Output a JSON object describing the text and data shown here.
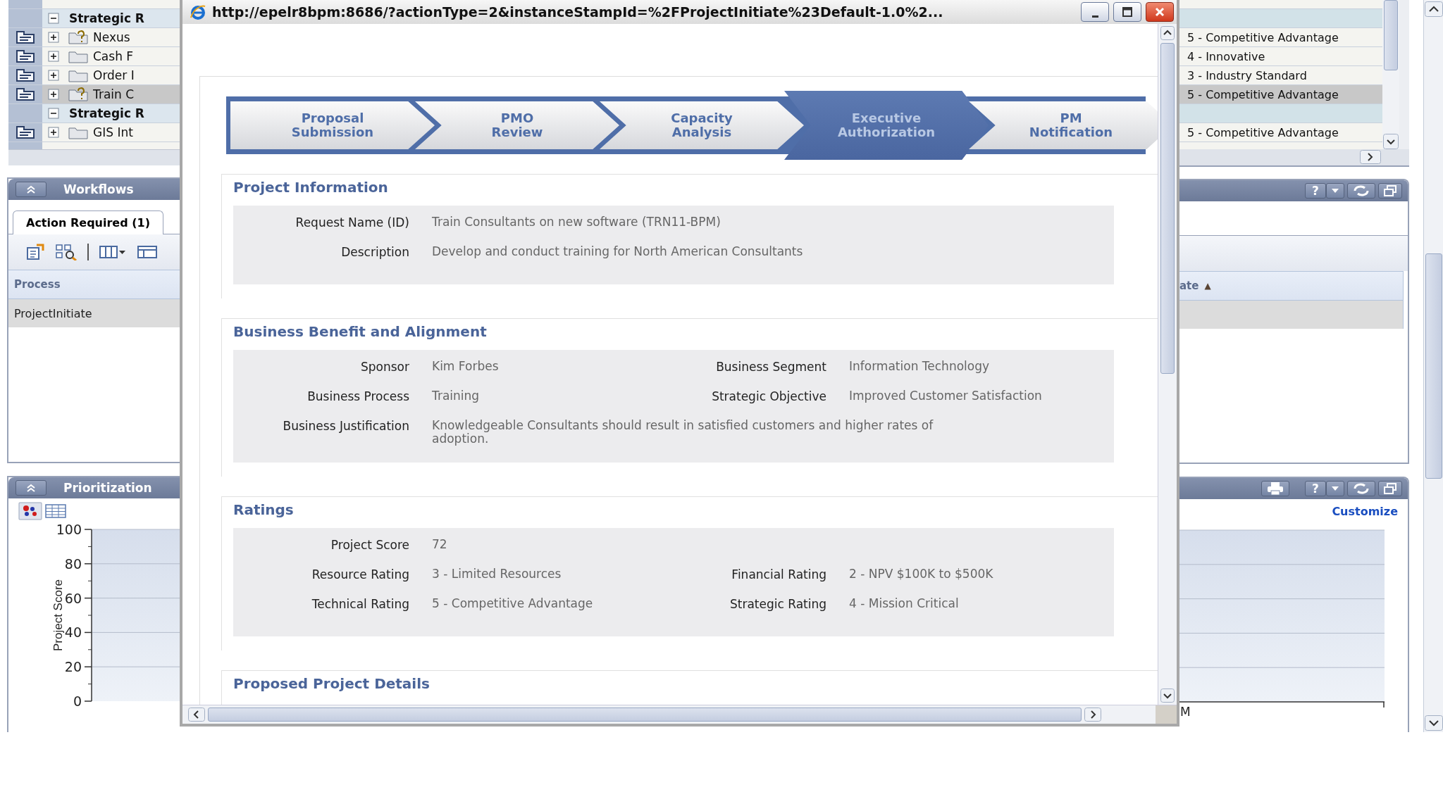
{
  "background": {
    "tree": {
      "rows": [
        {
          "kind": "group",
          "label": "Strategic R",
          "expanded": true,
          "selected": false
        },
        {
          "kind": "flagged",
          "label": "Nexus",
          "rating": "5 - Competitive Advantage",
          "expanded": false,
          "selected": false
        },
        {
          "kind": "item",
          "label": "Cash F",
          "rating": "4 - Innovative",
          "expanded": false,
          "selected": false
        },
        {
          "kind": "item",
          "label": "Order I",
          "rating": "3 - Industry Standard",
          "expanded": false,
          "selected": false
        },
        {
          "kind": "flagged",
          "label": "Train C",
          "rating": "5 - Competitive Advantage",
          "expanded": false,
          "selected": true
        },
        {
          "kind": "group",
          "label": "Strategic R",
          "expanded": true,
          "selected": false
        },
        {
          "kind": "item",
          "label": "GIS Int",
          "rating": "5 - Competitive Advantage",
          "expanded": false,
          "selected": false
        }
      ]
    },
    "workflows": {
      "title": "Workflows",
      "help": "?",
      "tab": "Action Required (1)",
      "columns": [
        {
          "label": "Process"
        },
        {
          "label": "ate",
          "marker": "▲"
        }
      ],
      "rows": [
        {
          "process": "ProjectInitiate",
          "selected": true
        }
      ]
    },
    "prioritization": {
      "title": "Prioritization",
      "help": "?",
      "link": "Customize",
      "chart": {
        "ylabel": "Project Score",
        "yticks": [
          "100",
          "80",
          "60",
          "40",
          "20",
          "0"
        ],
        "xlabel_tail": "M"
      }
    }
  },
  "popup": {
    "title": "http://epelr8bpm:8686/?actionType=2&instanceStampId=%2FProjectInitiate%23Default-1.0%2...",
    "steps": [
      {
        "label": "Proposal Submission",
        "selected": false
      },
      {
        "label": "PMO Review",
        "selected": false
      },
      {
        "label": "Capacity Analysis",
        "selected": false
      },
      {
        "label": "Executive Authorization",
        "selected": true
      },
      {
        "label": "PM Notification",
        "selected": false
      }
    ],
    "sections": [
      {
        "title": "Project Information",
        "rows": [
          [
            {
              "label": "Request Name (ID)",
              "value": "Train Consultants on new software (TRN11-BPM)"
            }
          ],
          [
            {
              "label": "Description",
              "value": "Develop and conduct training for North American Consultants"
            }
          ]
        ]
      },
      {
        "title": "Business Benefit and Alignment",
        "rows": [
          [
            {
              "label": "Sponsor",
              "value": "Kim Forbes"
            },
            {
              "label": "Business Segment",
              "value": "Information Technology"
            }
          ],
          [
            {
              "label": "Business Process",
              "value": "Training"
            },
            {
              "label": "Strategic Objective",
              "value": "Improved Customer Satisfaction"
            }
          ],
          [
            {
              "label": "Business Justification",
              "value": "Knowledgeable Consultants should result in satisfied customers and higher rates of adoption."
            }
          ]
        ]
      },
      {
        "title": "Ratings",
        "rows": [
          [
            {
              "label": "Project Score",
              "value": "72"
            }
          ],
          [
            {
              "label": "Resource Rating",
              "value": "3 - Limited Resources"
            },
            {
              "label": "Financial Rating",
              "value": "2 - NPV $100K to $500K"
            }
          ],
          [
            {
              "label": "Technical Rating",
              "value": "5 - Competitive Advantage"
            },
            {
              "label": "Strategic Rating",
              "value": "4 - Mission Critical"
            }
          ]
        ]
      },
      {
        "title": "Proposed Project Details"
      }
    ]
  }
}
